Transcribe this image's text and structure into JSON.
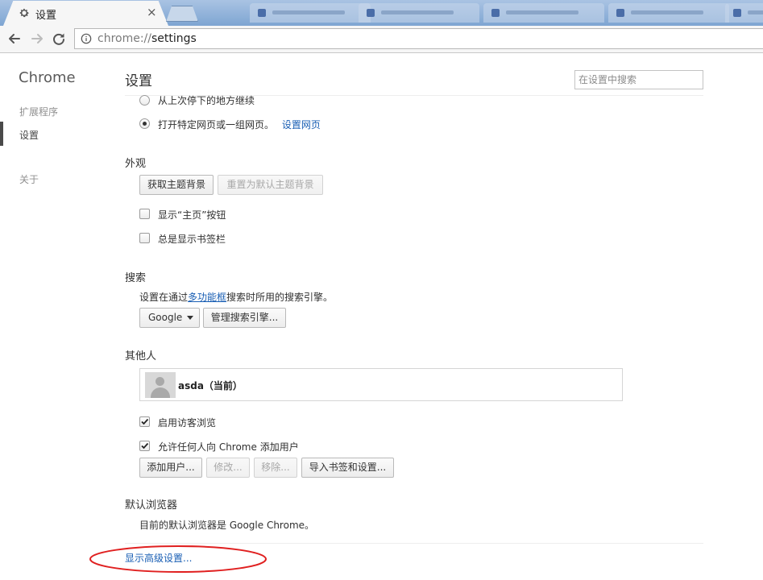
{
  "tabs": {
    "active": {
      "title": "设置",
      "close": "×"
    }
  },
  "toolbar": {
    "url_scheme": "chrome://",
    "url_host": "settings"
  },
  "sidebar": {
    "title": "Chrome",
    "items": [
      {
        "label": "扩展程序",
        "selected": false
      },
      {
        "label": "设置",
        "selected": true
      },
      {
        "label": "关于",
        "selected": false
      }
    ]
  },
  "header": {
    "title": "设置",
    "search_placeholder": "在设置中搜索"
  },
  "startup": {
    "option_continue": "从上次停下的地方继续",
    "option_specific": "打开特定网页或一组网页。",
    "set_pages_link": "设置网页",
    "selected": "specific"
  },
  "appearance": {
    "title": "外观",
    "get_themes_button": "获取主题背景",
    "reset_theme_button": "重置为默认主题背景",
    "show_home_label": "显示“主页”按钮",
    "show_home_checked": false,
    "show_bookmarks_label": "总是显示书签栏",
    "show_bookmarks_checked": false
  },
  "search": {
    "title": "搜索",
    "desc_before": "设置在通过",
    "desc_link": "多功能框",
    "desc_after": "搜索时所用的搜索引擎。",
    "engine": "Google",
    "manage_button": "管理搜索引擎..."
  },
  "people": {
    "title": "其他人",
    "profile_name": "asda（当前）",
    "guest_label": "启用访客浏览",
    "guest_checked": true,
    "add_anyone_label": "允许任何人向 Chrome 添加用户",
    "add_anyone_checked": true,
    "add_button": "添加用户...",
    "edit_button": "修改...",
    "remove_button": "移除...",
    "import_button": "导入书签和设置..."
  },
  "default_browser": {
    "title": "默认浏览器",
    "desc": "目前的默认浏览器是 Google Chrome。"
  },
  "advanced_link": "显示高级设置...",
  "colors": {
    "link": "#1a5fb4",
    "annotation": "#e02020"
  }
}
